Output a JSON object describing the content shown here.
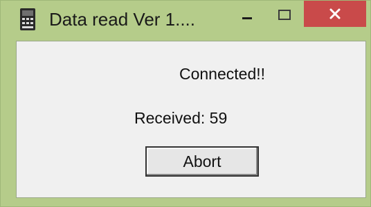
{
  "window": {
    "title": "Data read  Ver 1....",
    "app_icon": "calculator-device-icon",
    "controls": {
      "minimize_icon": "minimize-icon",
      "maximize_icon": "maximize-icon",
      "close_icon": "close-icon"
    },
    "colors": {
      "frame": "#b5cc8a",
      "close": "#c94a4a",
      "client": "#f0f0f0"
    }
  },
  "dialog": {
    "status": "Connected!!",
    "received": "Received: 59",
    "abort_label": "Abort"
  }
}
